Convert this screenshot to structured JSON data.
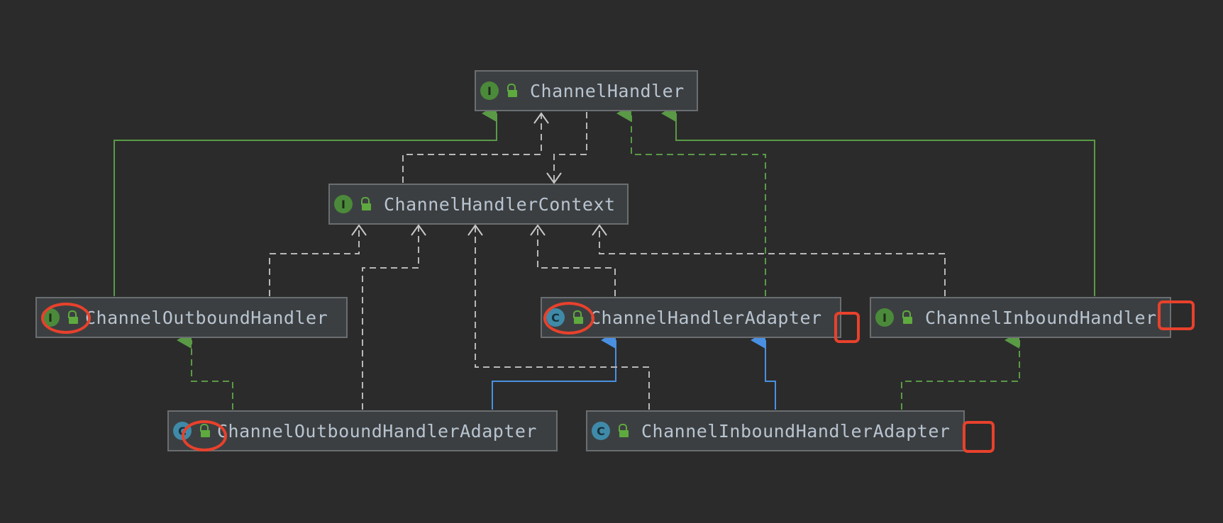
{
  "nodes": {
    "channel_handler": {
      "kind": "I",
      "label": "ChannelHandler"
    },
    "channel_handler_context": {
      "kind": "I",
      "label": "ChannelHandlerContext"
    },
    "channel_outbound_handler": {
      "kind": "I",
      "label": "ChannelOutboundHandler"
    },
    "channel_handler_adapter": {
      "kind": "C",
      "label": "ChannelHandlerAdapter"
    },
    "channel_inbound_handler": {
      "kind": "I",
      "label": "ChannelInboundHandler"
    },
    "channel_outbound_handler_adapter": {
      "kind": "C",
      "label": "ChannelOutboundHandlerAdapter"
    },
    "channel_inbound_handler_adapter": {
      "kind": "C",
      "label": "ChannelInboundHandlerAdapter"
    }
  },
  "colors": {
    "background": "#2b2b2b",
    "extends_interface": "#5a9a46",
    "extends_class": "#4a90e2",
    "dependency": "#b8b8b8",
    "annotation": "#e8412c"
  },
  "edges": [
    {
      "from": "channel_outbound_handler",
      "to": "channel_handler",
      "relation": "extends-interface",
      "style": "solid-green"
    },
    {
      "from": "channel_inbound_handler",
      "to": "channel_handler",
      "relation": "extends-interface",
      "style": "solid-green"
    },
    {
      "from": "channel_handler_adapter",
      "to": "channel_handler",
      "relation": "implements",
      "style": "dashed-green"
    },
    {
      "from": "channel_handler_context",
      "to": "channel_handler",
      "relation": "uses",
      "style": "dashed-gray"
    },
    {
      "from": "channel_handler",
      "to": "channel_handler_context",
      "relation": "uses",
      "style": "dashed-gray"
    },
    {
      "from": "channel_outbound_handler",
      "to": "channel_handler_context",
      "relation": "uses",
      "style": "dashed-gray"
    },
    {
      "from": "channel_outbound_handler_adapter",
      "to": "channel_handler_context",
      "relation": "uses",
      "style": "dashed-gray"
    },
    {
      "from": "channel_inbound_handler_adapter",
      "to": "channel_handler_context",
      "relation": "uses",
      "style": "dashed-gray"
    },
    {
      "from": "channel_handler_adapter",
      "to": "channel_handler_context",
      "relation": "uses",
      "style": "dashed-gray"
    },
    {
      "from": "channel_inbound_handler",
      "to": "channel_handler_context",
      "relation": "uses",
      "style": "dashed-gray"
    },
    {
      "from": "channel_outbound_handler_adapter",
      "to": "channel_outbound_handler",
      "relation": "implements",
      "style": "dashed-green"
    },
    {
      "from": "channel_outbound_handler_adapter",
      "to": "channel_handler_adapter",
      "relation": "extends-class",
      "style": "solid-blue"
    },
    {
      "from": "channel_inbound_handler_adapter",
      "to": "channel_handler_adapter",
      "relation": "extends-class",
      "style": "solid-blue"
    },
    {
      "from": "channel_inbound_handler_adapter",
      "to": "channel_inbound_handler",
      "relation": "implements",
      "style": "dashed-green"
    }
  ]
}
